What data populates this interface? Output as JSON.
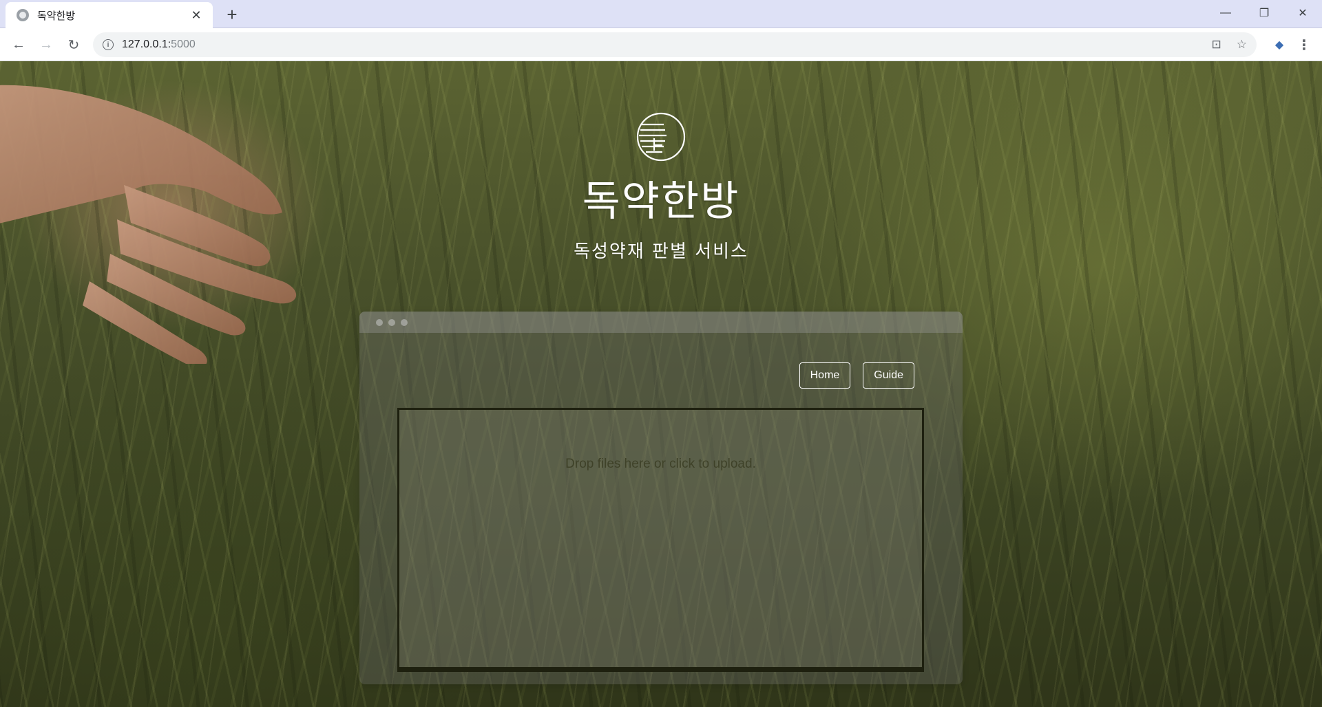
{
  "browser": {
    "tab": {
      "title": "독약한방",
      "close": "✕"
    },
    "new_tab": "+",
    "window_controls": {
      "minimize": "—",
      "restore": "❐",
      "close": "✕"
    },
    "nav": {
      "back": "←",
      "forward": "→",
      "reload": "↻"
    },
    "address": {
      "info": "i",
      "host": "127.0.0.1:",
      "port": "5000"
    },
    "omnibox_icons": {
      "translate": "⊡",
      "bookmark": "☆"
    },
    "extension": "◆",
    "menu": "⋮"
  },
  "hero": {
    "logo": "logo-circle-icon",
    "title": "독약한방",
    "subtitle": "독성약재 판별 서비스"
  },
  "panel": {
    "buttons": {
      "home": "Home",
      "guide": "Guide"
    },
    "dropzone_text": "Drop files here or click to upload."
  }
}
